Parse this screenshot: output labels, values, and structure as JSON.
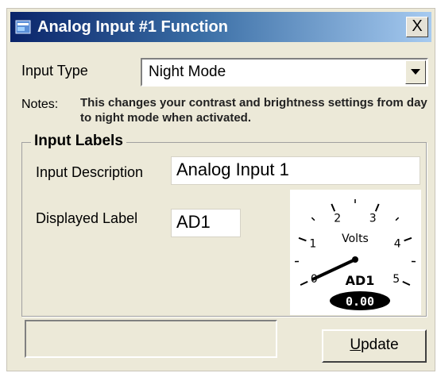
{
  "window": {
    "title": "Analog Input #1 Function",
    "close_label": "X"
  },
  "input_type": {
    "label": "Input Type",
    "value": "Night Mode"
  },
  "notes": {
    "label": "Notes:",
    "text": "This changes your contrast and brightness settings from day to night mode when activated."
  },
  "input_labels": {
    "group_title": "Input Labels",
    "description_label": "Input Description",
    "description_value": "Analog Input 1",
    "displayed_label_label": "Displayed Label",
    "displayed_label_value": "AD1"
  },
  "gauge": {
    "unit": "Volts",
    "tag": "AD1",
    "readout": "0.00",
    "scale_labels": [
      "0",
      "1",
      "2",
      "3",
      "4",
      "5"
    ],
    "needle_value": 0.0
  },
  "footer": {
    "status_text": "",
    "update_mnemonic": "U",
    "update_rest": "pdate"
  },
  "colors": {
    "title_start": "#0a246a",
    "title_end": "#a6caf0",
    "dialog_bg": "#ece9d8"
  },
  "icons": {
    "title": "app-window-icon",
    "dropdown": "chevron-down-icon"
  }
}
